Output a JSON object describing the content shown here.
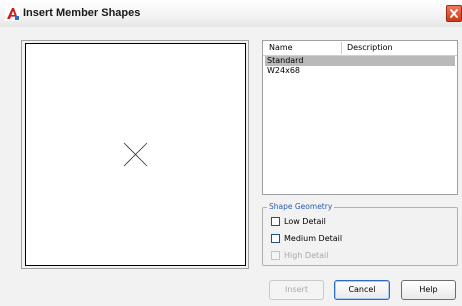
{
  "window": {
    "title": "Insert Member Shapes"
  },
  "list": {
    "columns": [
      "Name",
      "Description"
    ],
    "rows": [
      {
        "name": "Standard",
        "description": "",
        "selected": true
      },
      {
        "name": "W24x68",
        "description": "",
        "selected": false
      }
    ]
  },
  "geometry_group": {
    "label": "Shape Geometry",
    "options": [
      {
        "label": "Low Detail",
        "checked": false,
        "enabled": true
      },
      {
        "label": "Medium Detail",
        "checked": false,
        "enabled": true
      },
      {
        "label": "High Detail",
        "checked": false,
        "enabled": false
      }
    ]
  },
  "buttons": {
    "insert": "Insert",
    "cancel": "Cancel",
    "help": "Help"
  },
  "colors": {
    "selection": "#b9b9b9",
    "group_label": "#2a5fb0",
    "close": "#cc3a1a"
  },
  "icons": {
    "app": "autocad-a-icon",
    "close": "close-x-icon",
    "preview": "x-cross-icon"
  }
}
